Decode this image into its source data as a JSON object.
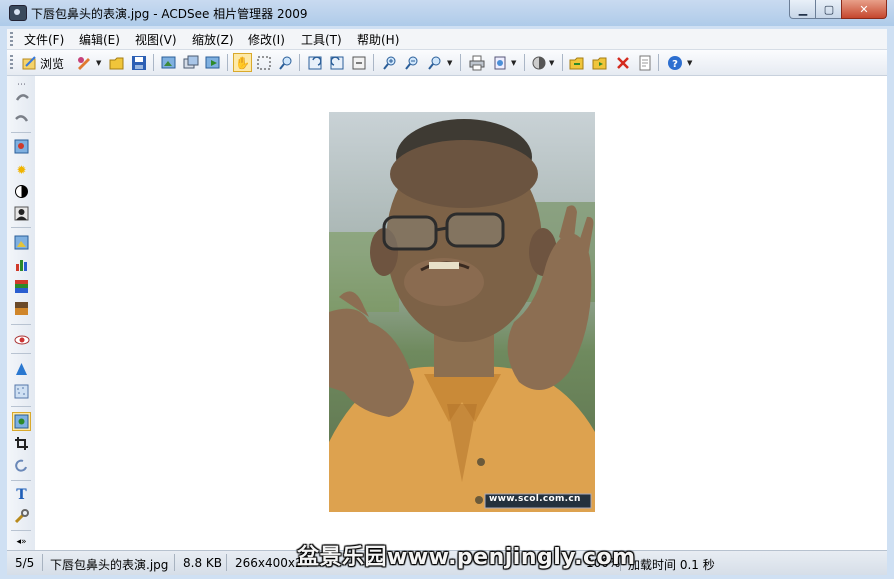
{
  "window": {
    "title": "下唇包鼻头的表演.jpg - ACDSee 相片管理器 2009",
    "controls": [
      "minimize",
      "maximize",
      "close"
    ]
  },
  "menu": [
    {
      "label": "文件(F)"
    },
    {
      "label": "编辑(E)"
    },
    {
      "label": "视图(V)"
    },
    {
      "label": "缩放(Z)"
    },
    {
      "label": "修改(I)"
    },
    {
      "label": "工具(T)"
    },
    {
      "label": "帮助(H)"
    }
  ],
  "toolbar": {
    "browse_label": "浏览",
    "icons": [
      "browse-icon",
      "edit-icon",
      "open-folder-icon",
      "save-icon",
      "image-import-icon",
      "batch-icon",
      "export-icon",
      "hand-tool-icon",
      "select-tool-icon",
      "zoom-tool-icon",
      "rotate-left-icon",
      "rotate-right-icon",
      "auto-rotate-icon",
      "zoom-in-icon",
      "zoom-out-icon",
      "zoom-menu-icon",
      "print-icon",
      "share-icon",
      "view-mode-icon",
      "previous-icon",
      "next-icon",
      "delete-icon",
      "properties-icon",
      "help-icon"
    ]
  },
  "sidebar": {
    "icons": [
      "undo-icon",
      "redo-icon",
      "red-eye-icon",
      "light-icon",
      "contrast-icon",
      "portrait-icon",
      "photo-repair-icon",
      "levels-icon",
      "color-balance-icon",
      "gradient-icon",
      "eye-icon",
      "sharpen-icon",
      "noise-icon",
      "edit-mode-icon",
      "crop-icon",
      "rotate-icon",
      "text-icon",
      "tools-icon",
      "expand-icon"
    ]
  },
  "image": {
    "watermark": "www.scol.com.cn"
  },
  "status": {
    "position": "5/5",
    "filename": "下唇包鼻头的表演.jpg",
    "filesize": "8.8 KB",
    "dimensions": "266x400x24",
    "zoom": "100%",
    "load_time": "加载时间 0.1 秒",
    "overlay_watermark": "盆景乐园www.penjingly.com"
  },
  "colors": {
    "accent": "#fde9a8",
    "close_button": "#c5472e",
    "canvas": "#ffffff"
  }
}
